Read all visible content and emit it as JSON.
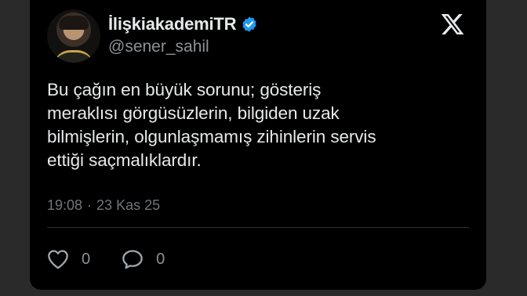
{
  "author": {
    "display_name": "İlişkiakademiTR",
    "handle": "@sener_sahil",
    "verified": true,
    "avatar_icon": "profile-photo"
  },
  "tweet": {
    "lines": [
      "Bu çağın en büyük sorunu; gösteriş",
      "meraklısı görgüsüzlerin, bilgiden uzak",
      "bilmişlerin, olgunlaşmamış zihinlerin servis",
      "ettiği saçmalıklardır."
    ],
    "time": "19:08",
    "separator": "·",
    "date": "23 Kas 25"
  },
  "actions": {
    "like_count": "0",
    "reply_count": "0"
  },
  "colors": {
    "background": "#000000",
    "text": "#e7e9ea",
    "muted": "#71767b",
    "verified": "#1d9bf0"
  },
  "icons": {
    "platform_logo": "x-logo-icon",
    "verified": "verified-badge-icon",
    "like": "heart-icon",
    "reply": "speech-bubble-icon"
  }
}
